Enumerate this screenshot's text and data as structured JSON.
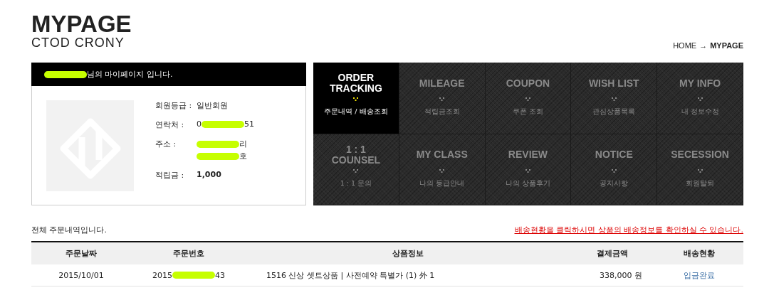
{
  "header": {
    "title": "MYPAGE",
    "subtitle": "CTOD CRONY",
    "breadcrumb": [
      {
        "label": "HOME",
        "current": false
      },
      {
        "label": "MYPAGE",
        "current": true
      }
    ],
    "breadcrumb_separator": "→"
  },
  "profile": {
    "greeting": "님의 마이페이지 입니다.",
    "fields": [
      {
        "label": "회원등급 :",
        "lines": [
          [
            {
              "kind": "text",
              "text": "일반회원"
            }
          ]
        ],
        "bold": false
      },
      {
        "label": "연락처 :",
        "lines": [
          [
            {
              "kind": "text",
              "text": "0"
            },
            {
              "kind": "redaction"
            },
            {
              "kind": "text",
              "text": "51"
            }
          ]
        ],
        "bold": false
      },
      {
        "label": "주소 :",
        "lines": [
          [
            {
              "kind": "redaction"
            },
            {
              "kind": "text",
              "text": "리"
            }
          ],
          [
            {
              "kind": "redaction"
            },
            {
              "kind": "text",
              "text": "호"
            }
          ]
        ],
        "bold": false
      },
      {
        "label": "적립금 :",
        "lines": [
          [
            {
              "kind": "text",
              "text": "1,000"
            }
          ]
        ],
        "bold": true
      }
    ]
  },
  "menu": [
    {
      "title": "ORDER TRACKING",
      "subtitle": "주문내역 / 배송조회",
      "selected": true
    },
    {
      "title": "MILEAGE",
      "subtitle": "적립금조회",
      "selected": false
    },
    {
      "title": "COUPON",
      "subtitle": "쿠폰 조회",
      "selected": false
    },
    {
      "title": "WISH LIST",
      "subtitle": "관심상품목록",
      "selected": false
    },
    {
      "title": "MY INFO",
      "subtitle": "내 정보수정",
      "selected": false
    },
    {
      "title": "1 : 1 COUNSEL",
      "subtitle": "1 : 1 문의",
      "selected": false
    },
    {
      "title": "MY CLASS",
      "subtitle": "나의 등급안내",
      "selected": false
    },
    {
      "title": "REVIEW",
      "subtitle": "나의 상품후기",
      "selected": false
    },
    {
      "title": "NOTICE",
      "subtitle": "공지사항",
      "selected": false
    },
    {
      "title": "SECESSION",
      "subtitle": "회원탈퇴",
      "selected": false
    }
  ],
  "orders": {
    "caption": "전체 주문내역입니다.",
    "notice_link": "배송현황을 클릭하시면 상품의 배송정보를 확인하실 수 있습니다.",
    "columns": [
      "주문날짜",
      "주문번호",
      "상품정보",
      "결제금액",
      "배송현황"
    ],
    "rows": [
      {
        "date": "2015/10/01",
        "order_no_start": "2015",
        "order_no_end": "43",
        "product": "1516 신상 셋트상품 | 사전예약 특별가 (1) 外 1",
        "amount": "338,000 원",
        "status": "입금완료"
      }
    ]
  }
}
